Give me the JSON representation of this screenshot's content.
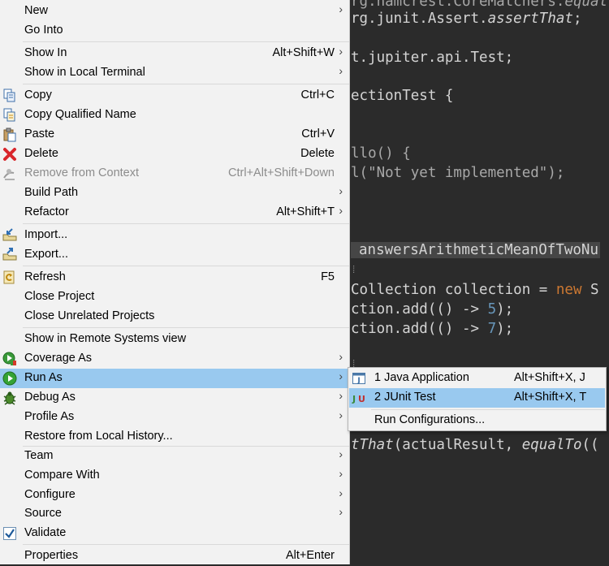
{
  "editor": {
    "lines": [
      "rg.hamcrest.CoreMatchers.",
      "equalTo",
      "rg.junit.Assert.",
      "assertThat",
      ";",
      "t.jupiter.api.Test;",
      "ectionTest {",
      "llo() {",
      "l(\"Not yet implemented\");",
      "answersArithmeticMeanOfTwoNu",
      "Collection collection = ",
      "new",
      " S",
      "ction.add(() -> ",
      "5",
      ");",
      "ction.add(() -> ",
      "7",
      ");",
      "tThat",
      "(actualResult, ",
      "equalTo",
      "(("
    ]
  },
  "context_menu": {
    "items": [
      {
        "label": "New"
      },
      {
        "label": "Go Into"
      },
      {
        "label": "Show In",
        "shortcut": "Alt+Shift+W"
      },
      {
        "label": "Show in Local Terminal"
      },
      {
        "label": "Copy",
        "shortcut": "Ctrl+C",
        "icon": "copy-icon"
      },
      {
        "label": "Copy Qualified Name",
        "icon": "copy-qualified-name-icon"
      },
      {
        "label": "Paste",
        "shortcut": "Ctrl+V",
        "icon": "paste-icon"
      },
      {
        "label": "Delete",
        "shortcut": "Delete",
        "icon": "delete-icon"
      },
      {
        "label": "Remove from Context",
        "shortcut": "Ctrl+Alt+Shift+Down",
        "icon": "remove-context-icon"
      },
      {
        "label": "Build Path"
      },
      {
        "label": "Refactor",
        "shortcut": "Alt+Shift+T"
      },
      {
        "label": "Import...",
        "icon": "import-icon"
      },
      {
        "label": "Export...",
        "icon": "export-icon"
      },
      {
        "label": "Refresh",
        "shortcut": "F5",
        "icon": "refresh-icon"
      },
      {
        "label": "Close Project"
      },
      {
        "label": "Close Unrelated Projects"
      },
      {
        "label": "Show in Remote Systems view"
      },
      {
        "label": "Coverage As",
        "icon": "coverage-icon"
      },
      {
        "label": "Run As",
        "icon": "run-icon"
      },
      {
        "label": "Debug As",
        "icon": "debug-icon"
      },
      {
        "label": "Profile As"
      },
      {
        "label": "Restore from Local History..."
      },
      {
        "label": "Team"
      },
      {
        "label": "Compare With"
      },
      {
        "label": "Configure"
      },
      {
        "label": "Source"
      },
      {
        "label": "Validate",
        "icon": "checkmark-icon"
      },
      {
        "label": "Properties",
        "shortcut": "Alt+Enter"
      }
    ]
  },
  "run_as_submenu": {
    "items": [
      {
        "label": "1 Java Application",
        "shortcut": "Alt+Shift+X, J",
        "icon": "java-application-icon"
      },
      {
        "label": "2 JUnit Test",
        "shortcut": "Alt+Shift+X, T",
        "icon": "junit-icon"
      },
      {
        "label": "Run Configurations..."
      }
    ]
  },
  "colors": {
    "menu_background": "#f2f2f2",
    "highlight": "#99c9ef",
    "editor_background": "#2b2b2b",
    "disabled_text": "#8c8c8c"
  }
}
